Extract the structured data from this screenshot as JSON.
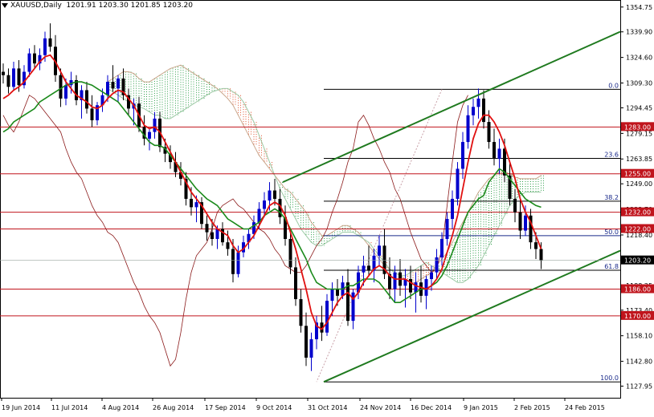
{
  "header": {
    "symbol": "XAUUSD,Daily",
    "ohlc": "1201.91 1203.30 1201.85 1203.20"
  },
  "chart_data": {
    "type": "candlestick",
    "title": "XAUUSD,Daily",
    "ylim": [
      1121.0,
      1358.0
    ],
    "y_ticks": [
      "1354.75",
      "1339.90",
      "1324.60",
      "1309.30",
      "1294.45",
      "1279.15",
      "1263.85",
      "1249.00",
      "1233.70",
      "1218.40",
      "1203.55",
      "1188.25",
      "1173.40",
      "1158.10",
      "1142.80",
      "1127.95"
    ],
    "x_ticks": [
      "19 Jun 2014",
      "11 Jul 2014",
      "4 Aug 2014",
      "26 Aug 2014",
      "17 Sep 2014",
      "9 Oct 2014",
      "31 Oct 2014",
      "24 Nov 2014",
      "16 Dec 2014",
      "9 Jan 2015",
      "2 Feb 2015",
      "24 Feb 2015"
    ],
    "current_price": "1203.20",
    "horizontal_levels": [
      {
        "label": "1283.00",
        "value": 1283.0
      },
      {
        "label": "1255.00",
        "value": 1255.0
      },
      {
        "label": "1232.00",
        "value": 1232.0
      },
      {
        "label": "1222.00",
        "value": 1222.0
      },
      {
        "label": "1186.00",
        "value": 1186.0
      },
      {
        "label": "1170.00",
        "value": 1170.0
      }
    ],
    "fibonacci": {
      "high": 1305.5,
      "low": 1130.5,
      "levels": [
        {
          "label": "0.0",
          "value": 1305.5
        },
        {
          "label": "23.6",
          "value": 1264.2
        },
        {
          "label": "38.2",
          "value": 1238.6
        },
        {
          "label": "50.0",
          "value": 1218.0
        },
        {
          "label": "61.8",
          "value": 1197.3
        },
        {
          "label": "100.0",
          "value": 1130.5
        }
      ]
    },
    "trendlines": [
      {
        "x": [
          81,
          131
        ],
        "y": [
          1250.0,
          1340.0
        ]
      },
      {
        "x": [
          81,
          131
        ],
        "y": [
          1130.5,
          1209.0
        ]
      }
    ],
    "candles": [
      {
        "o": 1316,
        "h": 1321,
        "l": 1309,
        "c": 1314
      },
      {
        "o": 1314,
        "h": 1318,
        "l": 1303,
        "c": 1307
      },
      {
        "o": 1307,
        "h": 1322,
        "l": 1305,
        "c": 1318
      },
      {
        "o": 1318,
        "h": 1323,
        "l": 1304,
        "c": 1308
      },
      {
        "o": 1308,
        "h": 1320,
        "l": 1306,
        "c": 1316
      },
      {
        "o": 1316,
        "h": 1330,
        "l": 1313,
        "c": 1327
      },
      {
        "o": 1327,
        "h": 1332,
        "l": 1318,
        "c": 1321
      },
      {
        "o": 1321,
        "h": 1330,
        "l": 1317,
        "c": 1326
      },
      {
        "o": 1326,
        "h": 1340,
        "l": 1322,
        "c": 1336
      },
      {
        "o": 1336,
        "h": 1345,
        "l": 1328,
        "c": 1331
      },
      {
        "o": 1331,
        "h": 1338,
        "l": 1310,
        "c": 1314
      },
      {
        "o": 1314,
        "h": 1318,
        "l": 1295,
        "c": 1300
      },
      {
        "o": 1300,
        "h": 1312,
        "l": 1296,
        "c": 1308
      },
      {
        "o": 1308,
        "h": 1316,
        "l": 1303,
        "c": 1311
      },
      {
        "o": 1311,
        "h": 1314,
        "l": 1296,
        "c": 1299
      },
      {
        "o": 1299,
        "h": 1308,
        "l": 1288,
        "c": 1305
      },
      {
        "o": 1305,
        "h": 1310,
        "l": 1291,
        "c": 1294
      },
      {
        "o": 1294,
        "h": 1302,
        "l": 1283,
        "c": 1287
      },
      {
        "o": 1287,
        "h": 1298,
        "l": 1284,
        "c": 1296
      },
      {
        "o": 1296,
        "h": 1306,
        "l": 1292,
        "c": 1302
      },
      {
        "o": 1302,
        "h": 1314,
        "l": 1298,
        "c": 1310
      },
      {
        "o": 1310,
        "h": 1320,
        "l": 1304,
        "c": 1306
      },
      {
        "o": 1306,
        "h": 1314,
        "l": 1298,
        "c": 1312
      },
      {
        "o": 1312,
        "h": 1318,
        "l": 1299,
        "c": 1302
      },
      {
        "o": 1302,
        "h": 1306,
        "l": 1290,
        "c": 1294
      },
      {
        "o": 1294,
        "h": 1300,
        "l": 1284,
        "c": 1297
      },
      {
        "o": 1297,
        "h": 1301,
        "l": 1280,
        "c": 1283
      },
      {
        "o": 1283,
        "h": 1290,
        "l": 1272,
        "c": 1276
      },
      {
        "o": 1276,
        "h": 1282,
        "l": 1269,
        "c": 1280
      },
      {
        "o": 1280,
        "h": 1292,
        "l": 1276,
        "c": 1288
      },
      {
        "o": 1288,
        "h": 1292,
        "l": 1268,
        "c": 1271
      },
      {
        "o": 1271,
        "h": 1276,
        "l": 1262,
        "c": 1267
      },
      {
        "o": 1267,
        "h": 1272,
        "l": 1258,
        "c": 1262
      },
      {
        "o": 1262,
        "h": 1268,
        "l": 1253,
        "c": 1256
      },
      {
        "o": 1256,
        "h": 1262,
        "l": 1248,
        "c": 1252
      },
      {
        "o": 1252,
        "h": 1256,
        "l": 1236,
        "c": 1240
      },
      {
        "o": 1240,
        "h": 1247,
        "l": 1230,
        "c": 1235
      },
      {
        "o": 1235,
        "h": 1242,
        "l": 1226,
        "c": 1238
      },
      {
        "o": 1238,
        "h": 1241,
        "l": 1222,
        "c": 1225
      },
      {
        "o": 1225,
        "h": 1230,
        "l": 1215,
        "c": 1220
      },
      {
        "o": 1220,
        "h": 1228,
        "l": 1212,
        "c": 1216
      },
      {
        "o": 1216,
        "h": 1224,
        "l": 1210,
        "c": 1222
      },
      {
        "o": 1222,
        "h": 1226,
        "l": 1212,
        "c": 1214
      },
      {
        "o": 1214,
        "h": 1221,
        "l": 1206,
        "c": 1210
      },
      {
        "o": 1210,
        "h": 1216,
        "l": 1190,
        "c": 1195
      },
      {
        "o": 1195,
        "h": 1212,
        "l": 1193,
        "c": 1208
      },
      {
        "o": 1208,
        "h": 1218,
        "l": 1205,
        "c": 1214
      },
      {
        "o": 1214,
        "h": 1222,
        "l": 1210,
        "c": 1219
      },
      {
        "o": 1219,
        "h": 1230,
        "l": 1216,
        "c": 1226
      },
      {
        "o": 1226,
        "h": 1238,
        "l": 1222,
        "c": 1234
      },
      {
        "o": 1234,
        "h": 1244,
        "l": 1229,
        "c": 1239
      },
      {
        "o": 1239,
        "h": 1250,
        "l": 1233,
        "c": 1245
      },
      {
        "o": 1245,
        "h": 1252,
        "l": 1236,
        "c": 1240
      },
      {
        "o": 1240,
        "h": 1246,
        "l": 1225,
        "c": 1229
      },
      {
        "o": 1229,
        "h": 1236,
        "l": 1212,
        "c": 1216
      },
      {
        "o": 1216,
        "h": 1222,
        "l": 1195,
        "c": 1199
      },
      {
        "o": 1199,
        "h": 1205,
        "l": 1176,
        "c": 1180
      },
      {
        "o": 1180,
        "h": 1186,
        "l": 1160,
        "c": 1164
      },
      {
        "o": 1164,
        "h": 1172,
        "l": 1140,
        "c": 1145
      },
      {
        "o": 1145,
        "h": 1160,
        "l": 1137,
        "c": 1156
      },
      {
        "o": 1156,
        "h": 1170,
        "l": 1150,
        "c": 1166
      },
      {
        "o": 1166,
        "h": 1176,
        "l": 1155,
        "c": 1160
      },
      {
        "o": 1160,
        "h": 1183,
        "l": 1158,
        "c": 1179
      },
      {
        "o": 1179,
        "h": 1190,
        "l": 1170,
        "c": 1186
      },
      {
        "o": 1186,
        "h": 1192,
        "l": 1176,
        "c": 1182
      },
      {
        "o": 1182,
        "h": 1194,
        "l": 1180,
        "c": 1190
      },
      {
        "o": 1190,
        "h": 1198,
        "l": 1164,
        "c": 1167
      },
      {
        "o": 1167,
        "h": 1186,
        "l": 1162,
        "c": 1184
      },
      {
        "o": 1184,
        "h": 1200,
        "l": 1180,
        "c": 1196
      },
      {
        "o": 1196,
        "h": 1206,
        "l": 1188,
        "c": 1200
      },
      {
        "o": 1200,
        "h": 1212,
        "l": 1194,
        "c": 1197
      },
      {
        "o": 1197,
        "h": 1210,
        "l": 1190,
        "c": 1206
      },
      {
        "o": 1206,
        "h": 1218,
        "l": 1200,
        "c": 1212
      },
      {
        "o": 1212,
        "h": 1222,
        "l": 1192,
        "c": 1195
      },
      {
        "o": 1195,
        "h": 1205,
        "l": 1180,
        "c": 1186
      },
      {
        "o": 1186,
        "h": 1200,
        "l": 1178,
        "c": 1196
      },
      {
        "o": 1196,
        "h": 1204,
        "l": 1182,
        "c": 1188
      },
      {
        "o": 1188,
        "h": 1198,
        "l": 1175,
        "c": 1192
      },
      {
        "o": 1192,
        "h": 1200,
        "l": 1180,
        "c": 1184
      },
      {
        "o": 1184,
        "h": 1196,
        "l": 1172,
        "c": 1190
      },
      {
        "o": 1190,
        "h": 1200,
        "l": 1178,
        "c": 1182
      },
      {
        "o": 1182,
        "h": 1194,
        "l": 1174,
        "c": 1192
      },
      {
        "o": 1192,
        "h": 1200,
        "l": 1185,
        "c": 1196
      },
      {
        "o": 1196,
        "h": 1210,
        "l": 1192,
        "c": 1205
      },
      {
        "o": 1205,
        "h": 1220,
        "l": 1200,
        "c": 1216
      },
      {
        "o": 1216,
        "h": 1232,
        "l": 1212,
        "c": 1228
      },
      {
        "o": 1228,
        "h": 1245,
        "l": 1222,
        "c": 1240
      },
      {
        "o": 1240,
        "h": 1262,
        "l": 1236,
        "c": 1258
      },
      {
        "o": 1258,
        "h": 1280,
        "l": 1252,
        "c": 1274
      },
      {
        "o": 1274,
        "h": 1296,
        "l": 1270,
        "c": 1290
      },
      {
        "o": 1290,
        "h": 1300,
        "l": 1284,
        "c": 1295
      },
      {
        "o": 1295,
        "h": 1306,
        "l": 1288,
        "c": 1300
      },
      {
        "o": 1300,
        "h": 1305,
        "l": 1282,
        "c": 1286
      },
      {
        "o": 1286,
        "h": 1293,
        "l": 1270,
        "c": 1274
      },
      {
        "o": 1274,
        "h": 1282,
        "l": 1260,
        "c": 1264
      },
      {
        "o": 1264,
        "h": 1276,
        "l": 1255,
        "c": 1270
      },
      {
        "o": 1270,
        "h": 1276,
        "l": 1250,
        "c": 1254
      },
      {
        "o": 1254,
        "h": 1262,
        "l": 1236,
        "c": 1240
      },
      {
        "o": 1240,
        "h": 1246,
        "l": 1226,
        "c": 1232
      },
      {
        "o": 1232,
        "h": 1240,
        "l": 1216,
        "c": 1221
      },
      {
        "o": 1221,
        "h": 1236,
        "l": 1218,
        "c": 1230
      },
      {
        "o": 1230,
        "h": 1234,
        "l": 1210,
        "c": 1214
      },
      {
        "o": 1214,
        "h": 1220,
        "l": 1204,
        "c": 1210
      },
      {
        "o": 1210,
        "h": 1214,
        "l": 1198,
        "c": 1203
      }
    ],
    "ma_red": [
      1300,
      1302,
      1305,
      1307,
      1310,
      1314,
      1318,
      1322,
      1325,
      1326,
      1322,
      1316,
      1310,
      1306,
      1302,
      1300,
      1298,
      1295,
      1294,
      1296,
      1300,
      1303,
      1305,
      1304,
      1300,
      1296,
      1290,
      1284,
      1282,
      1283,
      1280,
      1274,
      1268,
      1262,
      1256,
      1250,
      1244,
      1240,
      1236,
      1231,
      1226,
      1222,
      1220,
      1218,
      1212,
      1208,
      1210,
      1214,
      1218,
      1224,
      1230,
      1236,
      1238,
      1236,
      1230,
      1220,
      1210,
      1198,
      1186,
      1172,
      1164,
      1162,
      1166,
      1172,
      1178,
      1182,
      1184,
      1180,
      1184,
      1190,
      1194,
      1198,
      1200,
      1198,
      1194,
      1192,
      1192,
      1192,
      1190,
      1188,
      1187,
      1186,
      1188,
      1192,
      1198,
      1208,
      1218,
      1230,
      1246,
      1262,
      1276,
      1285,
      1290,
      1290,
      1286,
      1280,
      1272,
      1262,
      1252,
      1240,
      1232,
      1226,
      1218,
      1210
    ],
    "ma_green": [
      1280,
      1282,
      1286,
      1288,
      1290,
      1292,
      1294,
      1298,
      1300,
      1302,
      1304,
      1306,
      1308,
      1309,
      1310,
      1310,
      1309,
      1308,
      1306,
      1304,
      1302,
      1300,
      1298,
      1294,
      1290,
      1286,
      1282,
      1278,
      1274,
      1272,
      1272,
      1270,
      1266,
      1262,
      1258,
      1254,
      1250,
      1246,
      1243,
      1240,
      1238,
      1236,
      1232,
      1228,
      1226,
      1224,
      1222,
      1222,
      1224,
      1226,
      1230,
      1232,
      1234,
      1232,
      1228,
      1222,
      1216,
      1210,
      1204,
      1196,
      1190,
      1188,
      1186,
      1186,
      1186,
      1186,
      1188,
      1188,
      1190,
      1192,
      1192,
      1192,
      1190,
      1186,
      1182,
      1178,
      1178,
      1180,
      1182,
      1184,
      1186,
      1186,
      1188,
      1190,
      1194,
      1200,
      1208,
      1216,
      1224,
      1232,
      1236,
      1240,
      1242,
      1250,
      1254,
      1258,
      1256,
      1252,
      1248,
      1244,
      1240,
      1238,
      1236,
      1235
    ],
    "chikou": [
      1290,
      1284,
      1280,
      1286,
      1294,
      1302,
      1300,
      1296,
      1292,
      1288,
      1284,
      1280,
      1270,
      1262,
      1256,
      1252,
      1244,
      1236,
      1230,
      1226,
      1220,
      1218,
      1214,
      1206,
      1198,
      1190,
      1184,
      1176,
      1170,
      1166,
      1160,
      1150,
      1140,
      1144,
      1160,
      1180,
      1196,
      1206,
      1210,
      1214,
      1222,
      1232,
      1236,
      1238,
      1240,
      1236,
      1234,
      1230,
      1226,
      1222,
      1220,
      1216,
      1210,
      1206,
      1200,
      1198,
      1196,
      1196,
      1200,
      1206,
      1212,
      1216,
      1222,
      1232,
      1240,
      1250,
      1262,
      1270,
      1286,
      1290,
      1284,
      1276,
      1270,
      1262,
      1256,
      1246,
      1240,
      1230,
      1220,
      1212,
      1204,
      1200,
      1196,
      1198,
      1210,
      1236,
      1262,
      1286,
      1296,
      1302
    ],
    "cloud_a": [
      1310,
      1312,
      1314,
      1316,
      1316,
      1315,
      1312,
      1310,
      1310,
      1312,
      1314,
      1316,
      1318,
      1319,
      1320,
      1318,
      1316,
      1314,
      1312,
      1310,
      1308,
      1306,
      1303,
      1300,
      1296,
      1290,
      1284,
      1278,
      1272,
      1266,
      1262,
      1258,
      1254,
      1250,
      1246,
      1244,
      1240,
      1236,
      1232,
      1226,
      1222,
      1218,
      1218,
      1220,
      1222,
      1224,
      1224,
      1222,
      1220,
      1216,
      1212,
      1208,
      1204,
      1200,
      1198,
      1196,
      1194,
      1192,
      1190,
      1190,
      1192,
      1194,
      1196,
      1200,
      1204,
      1208,
      1214,
      1220,
      1226,
      1232,
      1238,
      1244,
      1248,
      1252,
      1254,
      1256,
      1256,
      1255,
      1253,
      1252,
      1252,
      1252,
      1252,
      1254
    ],
    "cloud_b": [
      1306,
      1304,
      1302,
      1300,
      1298,
      1296,
      1295,
      1294,
      1292,
      1290,
      1290,
      1288,
      1288,
      1290,
      1292,
      1294,
      1296,
      1298,
      1300,
      1302,
      1304,
      1305,
      1306,
      1306,
      1304,
      1302,
      1298,
      1292,
      1286,
      1278,
      1270,
      1262,
      1254,
      1246,
      1240,
      1234,
      1228,
      1222,
      1218,
      1214,
      1212,
      1212,
      1214,
      1216,
      1218,
      1220,
      1220,
      1220,
      1218,
      1216,
      1214,
      1210,
      1206,
      1202,
      1198,
      1196,
      1194,
      1194,
      1196,
      1198,
      1200,
      1202,
      1200,
      1198,
      1196,
      1194,
      1192,
      1190,
      1190,
      1192,
      1196,
      1200,
      1206,
      1212,
      1218,
      1224,
      1230,
      1236,
      1240,
      1242,
      1244,
      1244,
      1244,
      1244
    ]
  }
}
